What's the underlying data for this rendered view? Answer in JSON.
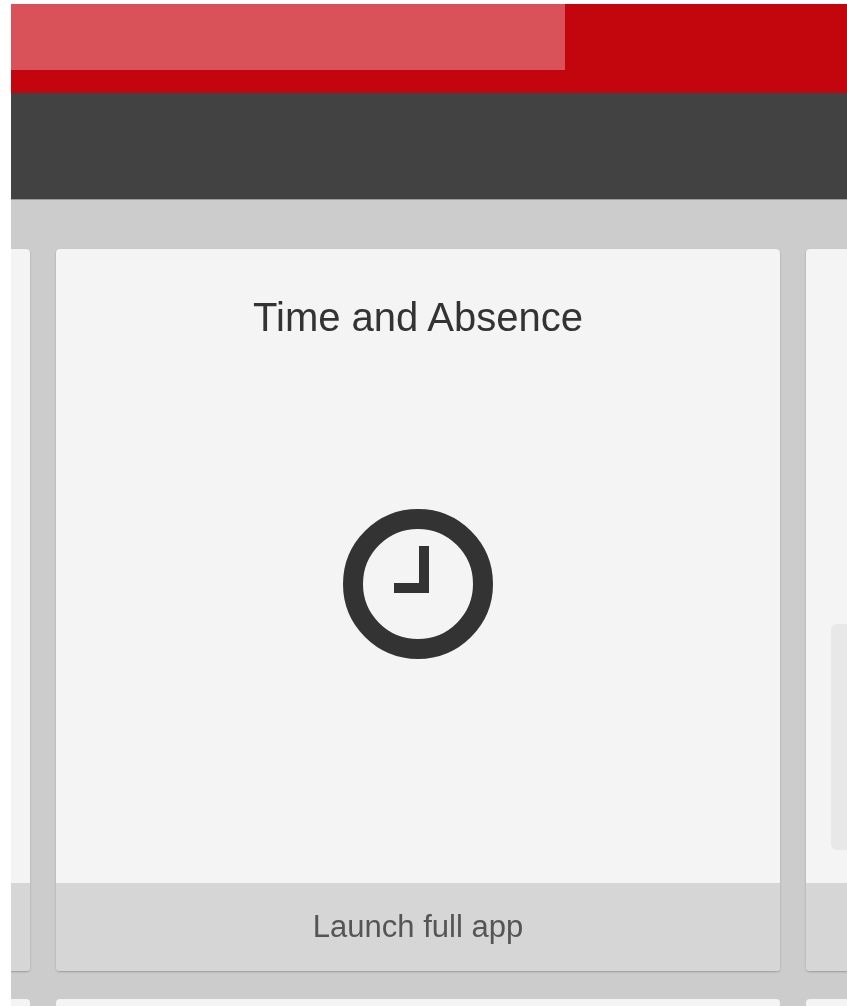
{
  "tile": {
    "title": "Time and Absence",
    "action": "Launch full app"
  }
}
